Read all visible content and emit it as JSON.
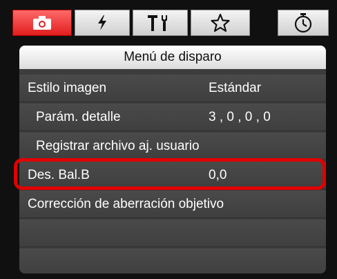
{
  "tabs": [
    {
      "name": "shooting",
      "icon": "camera-icon",
      "active": true
    },
    {
      "name": "flash",
      "icon": "flash-icon",
      "active": false
    },
    {
      "name": "tools",
      "icon": "tools-icon",
      "active": false
    },
    {
      "name": "my-menu",
      "icon": "star-icon",
      "active": false
    },
    {
      "name": "timer",
      "icon": "timer-icon",
      "active": false
    }
  ],
  "menu": {
    "title": "Menú de disparo",
    "items": [
      {
        "label": "Estilo imagen",
        "value": "Estándar"
      },
      {
        "label": "Parám. detalle",
        "value": "3 , 0 , 0 , 0"
      },
      {
        "label": "Registrar archivo aj. usuario",
        "value": ""
      },
      {
        "label": "Des. Bal.B",
        "value": "0,0"
      },
      {
        "label": "Corrección de aberración objetivo",
        "value": ""
      }
    ]
  },
  "colors": {
    "active_tab": "#e11d1d",
    "highlight_border": "#e00000",
    "panel_bg": "#3d3d3d"
  }
}
